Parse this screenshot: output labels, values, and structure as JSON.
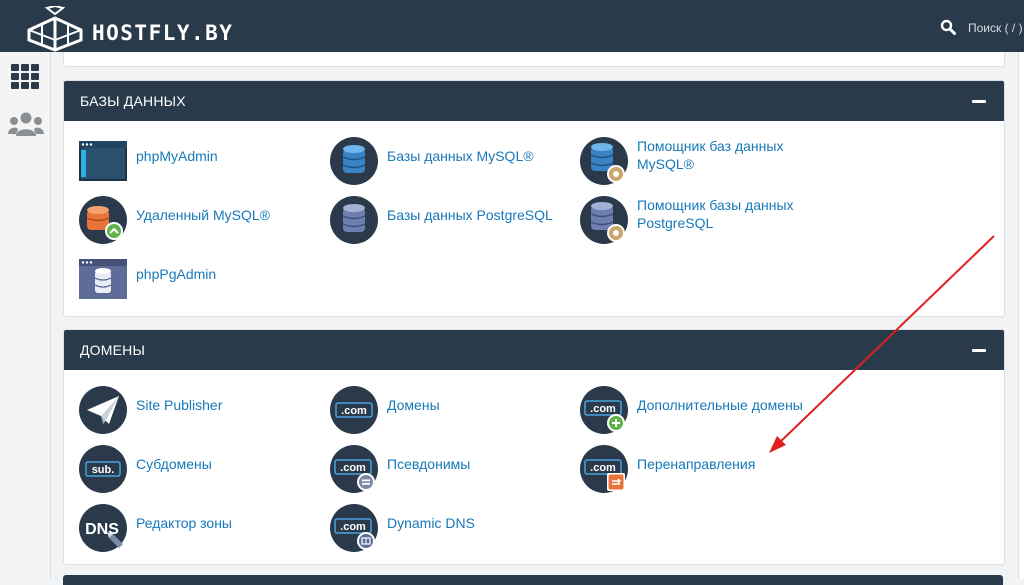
{
  "header": {
    "brand": "HOSTFLY.BY",
    "search_label": "Поиск ( / )"
  },
  "sidebar": {
    "icons": [
      "grid-icon",
      "users-icon"
    ]
  },
  "colors": {
    "header_bg": "#293a4a",
    "link": "#1779b9",
    "arrow": "#e02020"
  },
  "databases": {
    "title": "БАЗЫ ДАННЫХ",
    "items": [
      {
        "label": "phpMyAdmin",
        "icon": "phpmyadmin-icon"
      },
      {
        "label": "Базы данных MySQL®",
        "icon": "mysql-databases-icon"
      },
      {
        "label": "Помощник баз данных MySQL®",
        "icon": "mysql-wizard-icon"
      },
      {
        "label": "Удаленный MySQL®",
        "icon": "remote-mysql-icon"
      },
      {
        "label": "Базы данных PostgreSQL",
        "icon": "postgresql-databases-icon"
      },
      {
        "label": "Помощник базы данных PostgreSQL",
        "icon": "postgresql-wizard-icon"
      },
      {
        "label": "phpPgAdmin",
        "icon": "phppgadmin-icon"
      }
    ]
  },
  "domains": {
    "title": "ДОМЕНЫ",
    "items": [
      {
        "label": "Site Publisher",
        "icon": "site-publisher-icon"
      },
      {
        "label": "Домены",
        "icon": "domains-icon",
        "badge": ".com"
      },
      {
        "label": "Дополнительные домены",
        "icon": "addon-domains-icon",
        "badge": ".com"
      },
      {
        "label": "Субдомены",
        "icon": "subdomains-icon",
        "badge": "sub."
      },
      {
        "label": "Псевдонимы",
        "icon": "aliases-icon",
        "badge": ".com"
      },
      {
        "label": "Перенаправления",
        "icon": "redirects-icon",
        "badge": ".com"
      },
      {
        "label": "Редактор зоны",
        "icon": "zone-editor-icon",
        "badge": "DNS"
      },
      {
        "label": "Dynamic DNS",
        "icon": "dynamic-dns-icon",
        "badge": ".com"
      }
    ]
  }
}
